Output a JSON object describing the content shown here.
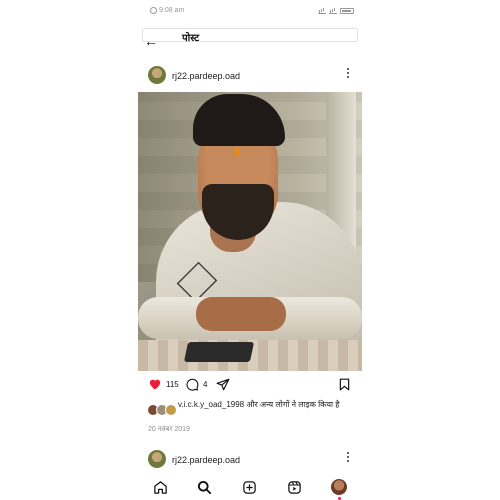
{
  "status_bar": {
    "time": "9:08 am",
    "battery": "58"
  },
  "header": {
    "title": "पोस्ट",
    "back_label": "←"
  },
  "post": {
    "username": "rj22.pardeep.oad",
    "likes_count": "115",
    "comments_count": "4",
    "liked_by_text": "v.i.c.k.y_oad_1998 और अन्य लोगों ने लाइक किया है",
    "date": "20 नवंबर 2019",
    "liked": true
  },
  "next_post": {
    "username": "rj22.pardeep.oad"
  },
  "nav": {
    "items": [
      "home-icon",
      "search-icon",
      "new-post-icon",
      "reels-icon",
      "profile-avatar"
    ]
  },
  "colors": {
    "like": "#ed1c3c",
    "text": "#111111",
    "muted": "#8e8e8e"
  }
}
